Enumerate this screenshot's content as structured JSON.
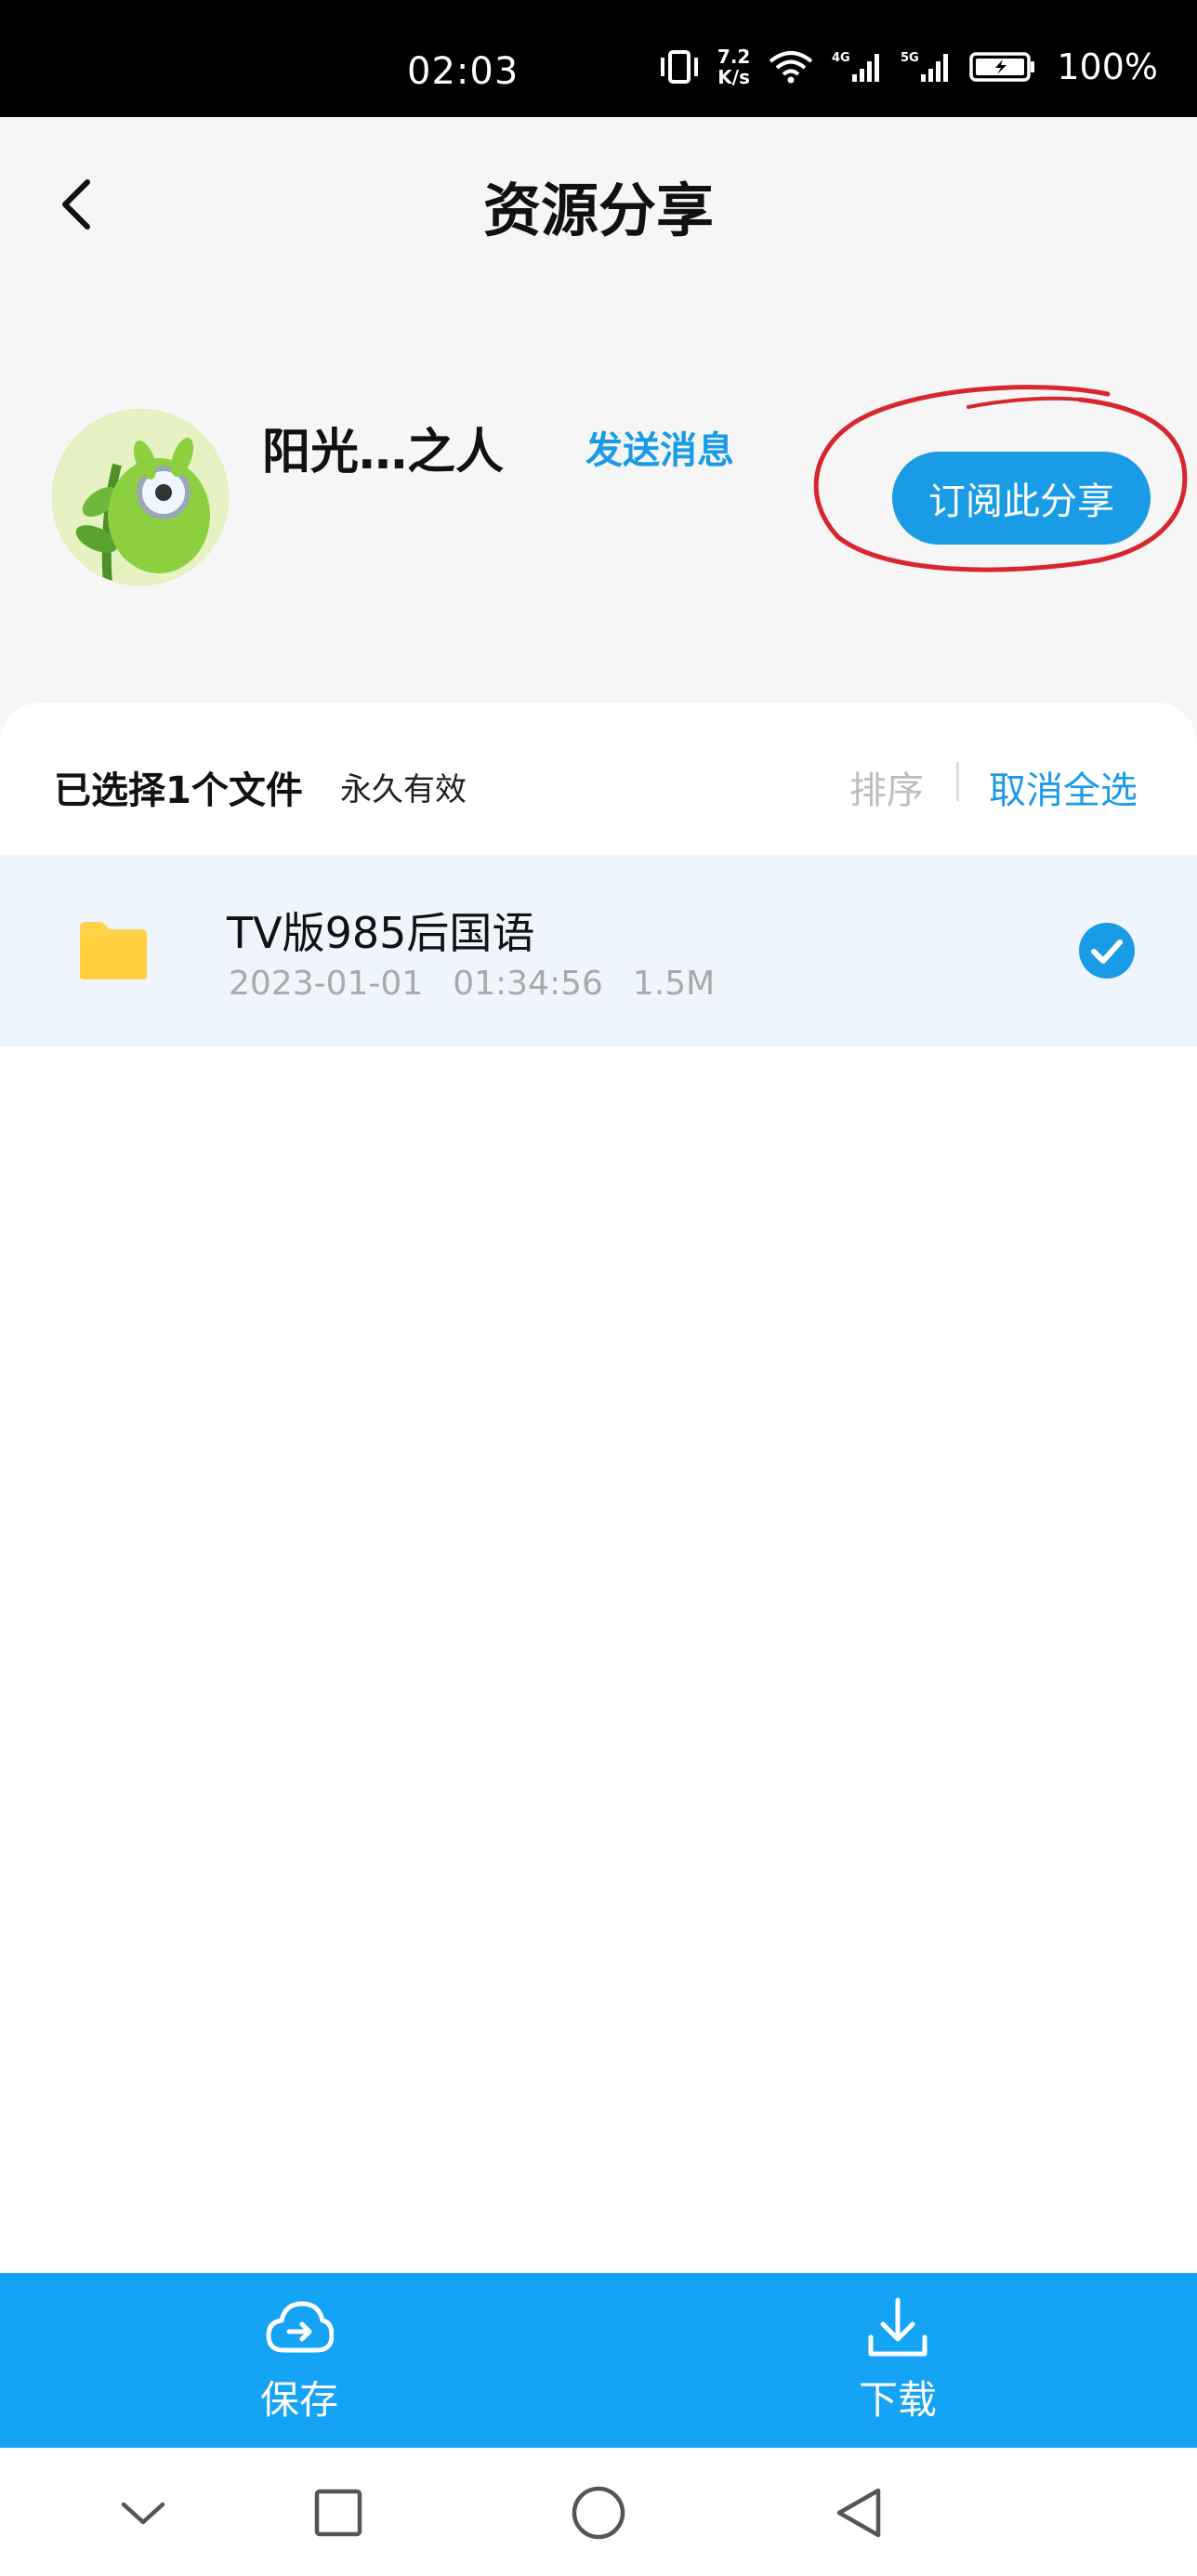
{
  "status_bar": {
    "time": "02:03",
    "net_speed_value": "7.2",
    "net_speed_unit": "K/s",
    "signal_1_label": "4G",
    "signal_2_label": "5G",
    "battery_percent": "100%"
  },
  "header": {
    "title": "资源分享",
    "back_icon": "chevron-left-icon"
  },
  "profile": {
    "username": "阳光…之人",
    "send_message_label": "发送消息",
    "subscribe_label": "订阅此分享"
  },
  "list_toolbar": {
    "selected_text": "已选择1个文件",
    "validity_text": "永久有效",
    "sort_label": "排序",
    "deselect_all_label": "取消全选"
  },
  "files": [
    {
      "name": "TV版985后国语",
      "date": "2023-01-01",
      "time": "01:34:56",
      "size": "1.5M",
      "icon": "folder-icon",
      "selected": true
    }
  ],
  "actions": {
    "save_label": "保存",
    "download_label": "下载"
  },
  "colors": {
    "accent": "#1a9be6",
    "action_bar": "#14a3f5",
    "folder": "#ffd24a",
    "annotation": "#d7262c"
  }
}
